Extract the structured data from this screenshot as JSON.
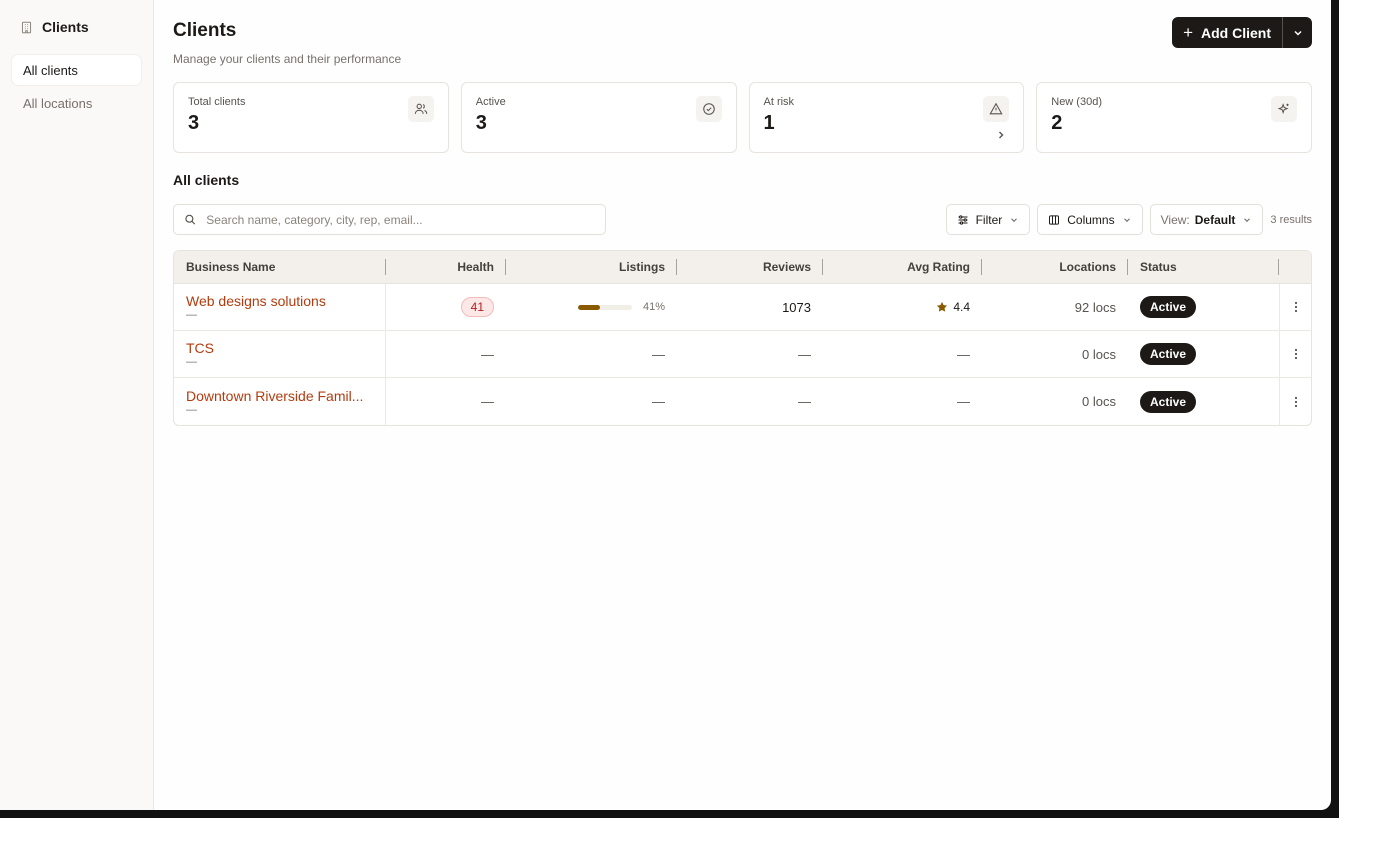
{
  "sidebar": {
    "title": "Clients",
    "items": [
      {
        "label": "All clients",
        "active": true
      },
      {
        "label": "All locations",
        "active": false
      }
    ]
  },
  "header": {
    "title": "Clients",
    "subtitle": "Manage your clients and their performance",
    "add_button": "Add Client"
  },
  "stats": [
    {
      "label": "Total clients",
      "value": "3",
      "icon": "users-icon"
    },
    {
      "label": "Active",
      "value": "3",
      "icon": "check-circle-icon"
    },
    {
      "label": "At risk",
      "value": "1",
      "icon": "warning-triangle-icon"
    },
    {
      "label": "New (30d)",
      "value": "2",
      "icon": "sparkles-icon"
    }
  ],
  "section_title": "All clients",
  "toolbar": {
    "search_placeholder": "Search name, category, city, rep, email...",
    "filter_label": "Filter",
    "columns_label": "Columns",
    "view_prefix": "View:",
    "view_value": "Default",
    "results": "3 results"
  },
  "table": {
    "headers": [
      "Business Name",
      "Health",
      "Listings",
      "Reviews",
      "Avg Rating",
      "Locations",
      "Status"
    ],
    "rows": [
      {
        "name": "Web designs solutions",
        "sub": "—",
        "health": "41",
        "listings_pct": 41,
        "listings_label": "41%",
        "reviews": "1073",
        "rating": "4.4",
        "locations": "92 locs",
        "status": "Active"
      },
      {
        "name": "TCS",
        "sub": "—",
        "health": "—",
        "listings_label": "—",
        "reviews": "—",
        "rating": "—",
        "locations": "0 locs",
        "status": "Active"
      },
      {
        "name": "Downtown Riverside Famil...",
        "sub": "—",
        "health": "—",
        "listings_label": "—",
        "reviews": "—",
        "rating": "—",
        "locations": "0 locs",
        "status": "Active"
      }
    ]
  },
  "colors": {
    "accent_dark": "#1c1917",
    "link": "#b23c0f",
    "health_bad": "#b91c1c",
    "listing_bar": "#8a5a00",
    "star": "#8a5a00"
  }
}
